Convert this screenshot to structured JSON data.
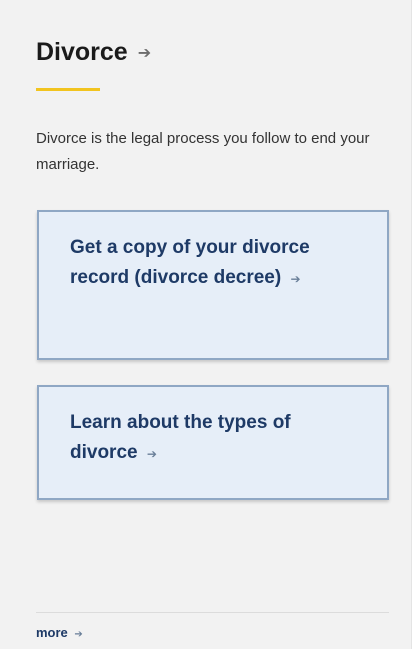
{
  "section": {
    "title": "Divorce",
    "title_arrow": "➔",
    "description": "Divorce is the legal process you follow to end your marriage."
  },
  "links": [
    {
      "label": "Get a copy of your divorce record (divorce decree)",
      "arrow": "➔"
    },
    {
      "label": "Learn about the types of divorce",
      "arrow": "➔"
    }
  ],
  "footer": {
    "more_label": "more",
    "more_arrow": "➔"
  },
  "colors": {
    "panel_bg": "#f2f2f2",
    "accent_underline": "#f2c41f",
    "link_box_bg": "#e6eef8",
    "link_box_border": "#8fa7c4",
    "link_text": "#1e3a66"
  }
}
